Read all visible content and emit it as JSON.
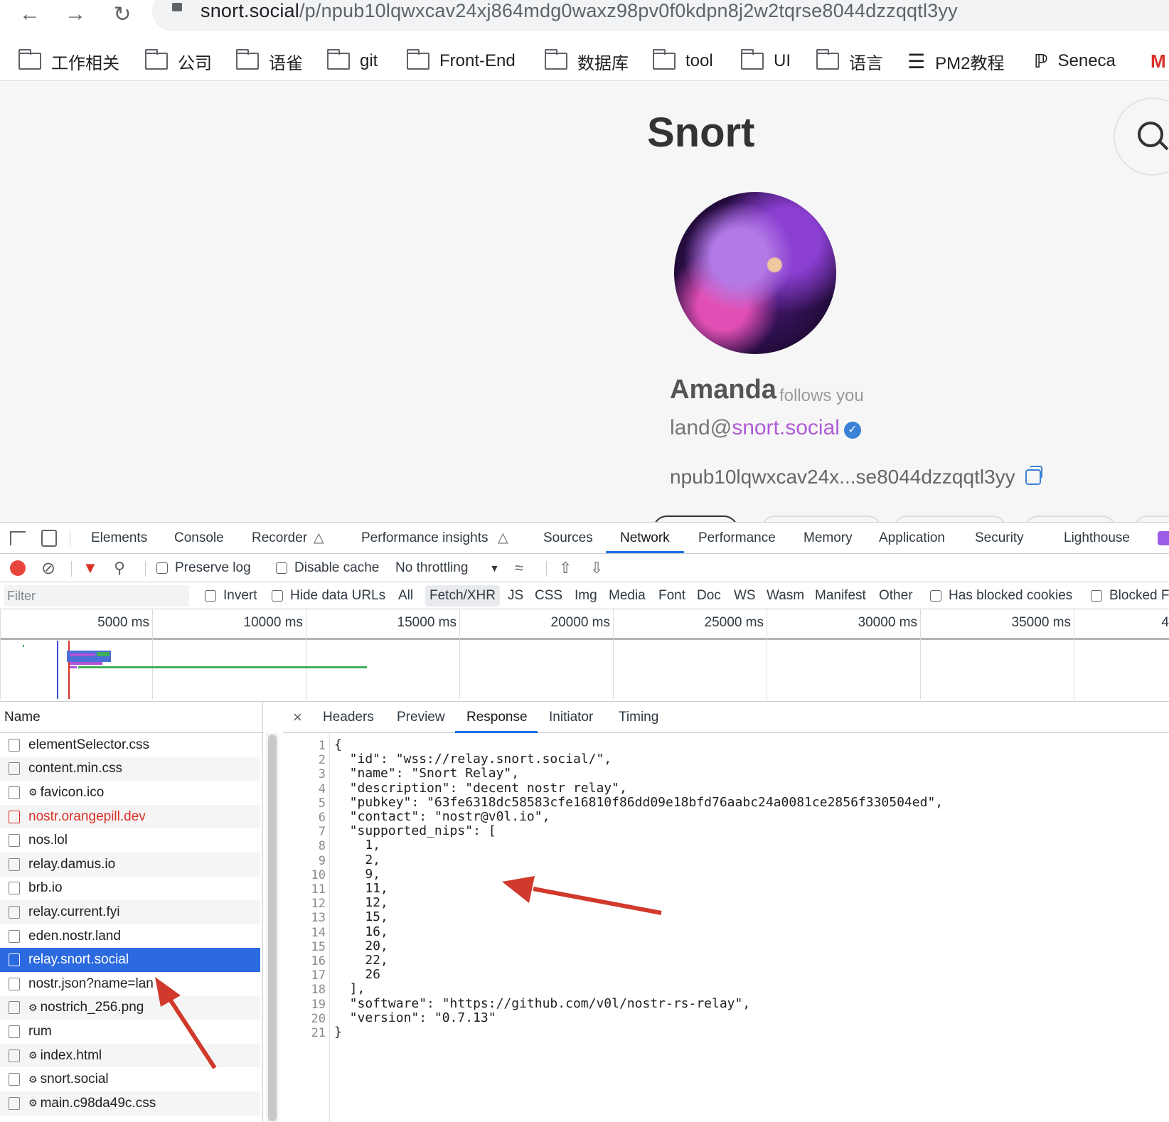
{
  "browser": {
    "url_host": "snort.social",
    "url_path": "/p/npub10lqwxcav24xj864mdg0waxz98pv0f0kdpn8j2w2tqrse8044dzzqqtl3yy",
    "bookmarks": [
      "工作相关",
      "公司",
      "语雀",
      "git",
      "Front-End",
      "数据库",
      "tool",
      "UI",
      "语言",
      "PM2教程",
      "Seneca"
    ]
  },
  "page": {
    "brand": "Snort",
    "profile_name": "Amanda",
    "follows_text": "follows you",
    "nip05_user": "land@",
    "nip05_domain": "snort.social",
    "npub": "npub10lqwxcav24x...se8044dzzqqtl3yy"
  },
  "devtools": {
    "tabs": [
      "Elements",
      "Console",
      "Recorder",
      "Performance insights",
      "Sources",
      "Network",
      "Performance",
      "Memory",
      "Application",
      "Security",
      "Lighthouse"
    ],
    "active_tab": "Network",
    "toolbar": {
      "preserve_log": "Preserve log",
      "disable_cache": "Disable cache",
      "throttling": "No throttling"
    },
    "filter": {
      "placeholder": "Filter",
      "invert": "Invert",
      "hide_data_urls": "Hide data URLs",
      "types": [
        "All",
        "Fetch/XHR",
        "JS",
        "CSS",
        "Img",
        "Media",
        "Font",
        "Doc",
        "WS",
        "Wasm",
        "Manifest",
        "Other"
      ],
      "selected_type": "Fetch/XHR",
      "has_blocked_cookies": "Has blocked cookies",
      "blocked": "Blocked F"
    },
    "timeline_ticks": [
      "5000 ms",
      "10000 ms",
      "15000 ms",
      "20000 ms",
      "25000 ms",
      "30000 ms",
      "35000 ms",
      "4"
    ],
    "name_header": "Name",
    "requests": [
      {
        "name": "elementSelector.css",
        "gear": false,
        "error": false
      },
      {
        "name": "content.min.css",
        "gear": false,
        "error": false
      },
      {
        "name": "favicon.ico",
        "gear": true,
        "error": false
      },
      {
        "name": "nostr.orangepill.dev",
        "gear": false,
        "error": true
      },
      {
        "name": "nos.lol",
        "gear": false,
        "error": false
      },
      {
        "name": "relay.damus.io",
        "gear": false,
        "error": false
      },
      {
        "name": "brb.io",
        "gear": false,
        "error": false
      },
      {
        "name": "relay.current.fyi",
        "gear": false,
        "error": false
      },
      {
        "name": "eden.nostr.land",
        "gear": false,
        "error": false
      },
      {
        "name": "relay.snort.social",
        "gear": false,
        "error": false,
        "selected": true
      },
      {
        "name": "nostr.json?name=lan",
        "gear": false,
        "error": false
      },
      {
        "name": "nostrich_256.png",
        "gear": true,
        "error": false
      },
      {
        "name": "rum",
        "gear": false,
        "error": false
      },
      {
        "name": "index.html",
        "gear": true,
        "error": false
      },
      {
        "name": "snort.social",
        "gear": true,
        "error": false
      },
      {
        "name": "main.c98da49c.css",
        "gear": true,
        "error": false
      }
    ],
    "detail_tabs": [
      "Headers",
      "Preview",
      "Response",
      "Initiator",
      "Timing"
    ],
    "active_detail_tab": "Response",
    "response_lines": [
      "{",
      "  \"id\": \"wss://relay.snort.social/\",",
      "  \"name\": \"Snort Relay\",",
      "  \"description\": \"decent nostr relay\",",
      "  \"pubkey\": \"63fe6318dc58583cfe16810f86dd09e18bfd76aabc24a0081ce2856f330504ed\",",
      "  \"contact\": \"nostr@v0l.io\",",
      "  \"supported_nips\": [",
      "    1,",
      "    2,",
      "    9,",
      "    11,",
      "    12,",
      "    15,",
      "    16,",
      "    20,",
      "    22,",
      "    26",
      "  ],",
      "  \"software\": \"https://github.com/v0l/nostr-rs-relay\",",
      "  \"version\": \"0.7.13\"",
      "}"
    ]
  },
  "colors": {
    "accent": "#1a73e8",
    "selected_row": "#2c6ae0",
    "error": "#d93025",
    "annotation_arrow": "#d0392b"
  }
}
